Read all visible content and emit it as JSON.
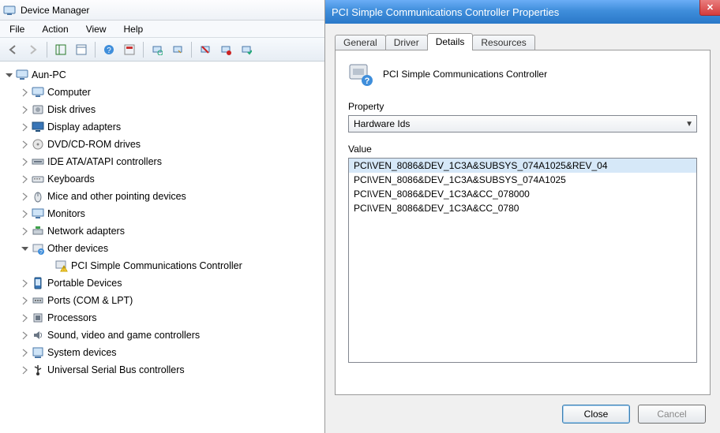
{
  "dm": {
    "title": "Device Manager",
    "menu": [
      "File",
      "Action",
      "View",
      "Help"
    ],
    "root": "Aun-PC",
    "nodes": [
      {
        "icon": "computer",
        "label": "Computer",
        "expand": "closed"
      },
      {
        "icon": "disk",
        "label": "Disk drives",
        "expand": "closed"
      },
      {
        "icon": "display",
        "label": "Display adapters",
        "expand": "closed"
      },
      {
        "icon": "dvd",
        "label": "DVD/CD-ROM drives",
        "expand": "closed"
      },
      {
        "icon": "ide",
        "label": "IDE ATA/ATAPI controllers",
        "expand": "closed"
      },
      {
        "icon": "keyboard",
        "label": "Keyboards",
        "expand": "closed"
      },
      {
        "icon": "mouse",
        "label": "Mice and other pointing devices",
        "expand": "closed"
      },
      {
        "icon": "monitor",
        "label": "Monitors",
        "expand": "closed"
      },
      {
        "icon": "network",
        "label": "Network adapters",
        "expand": "closed"
      },
      {
        "icon": "other",
        "label": "Other devices",
        "expand": "open",
        "children": [
          {
            "icon": "warn",
            "label": "PCI Simple Communications Controller"
          }
        ]
      },
      {
        "icon": "portable",
        "label": "Portable Devices",
        "expand": "closed"
      },
      {
        "icon": "ports",
        "label": "Ports (COM & LPT)",
        "expand": "closed"
      },
      {
        "icon": "cpu",
        "label": "Processors",
        "expand": "closed"
      },
      {
        "icon": "sound",
        "label": "Sound, video and game controllers",
        "expand": "closed"
      },
      {
        "icon": "system",
        "label": "System devices",
        "expand": "closed"
      },
      {
        "icon": "usb",
        "label": "Universal Serial Bus controllers",
        "expand": "closed"
      }
    ]
  },
  "props": {
    "title": "PCI Simple Communications Controller Properties",
    "tabs": [
      "General",
      "Driver",
      "Details",
      "Resources"
    ],
    "active_tab": 2,
    "device_name": "PCI Simple Communications Controller",
    "property_label": "Property",
    "property_value": "Hardware Ids",
    "value_label": "Value",
    "values": [
      "PCI\\VEN_8086&DEV_1C3A&SUBSYS_074A1025&REV_04",
      "PCI\\VEN_8086&DEV_1C3A&SUBSYS_074A1025",
      "PCI\\VEN_8086&DEV_1C3A&CC_078000",
      "PCI\\VEN_8086&DEV_1C3A&CC_0780"
    ],
    "selected_value": 0,
    "close_label": "Close",
    "cancel_label": "Cancel"
  }
}
